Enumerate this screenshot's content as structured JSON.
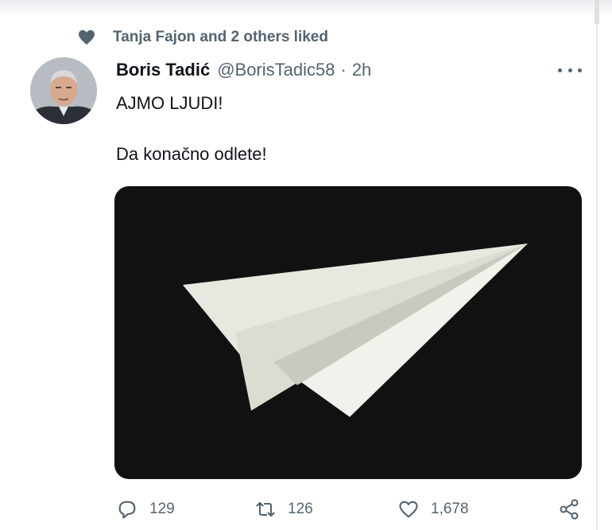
{
  "social_context": {
    "text": "Tanja Fajon and 2 others liked",
    "icon": "heart-icon"
  },
  "tweet": {
    "author_name": "Boris Tadić",
    "handle": "@BorisTadic58",
    "separator": "·",
    "time": "2h",
    "text_line1": "AJMO LJUDI!",
    "text_line2": "Da konačno odlete!",
    "media": {
      "description_icon": "paper-plane-image"
    }
  },
  "actions": {
    "reply_count": "129",
    "retweet_count": "126",
    "like_count": "1,678",
    "icons": [
      "reply-icon",
      "retweet-icon",
      "like-icon",
      "share-icon"
    ]
  },
  "colors": {
    "text": "#0f1419",
    "secondary": "#536471",
    "media_bg": "#0f1210"
  }
}
